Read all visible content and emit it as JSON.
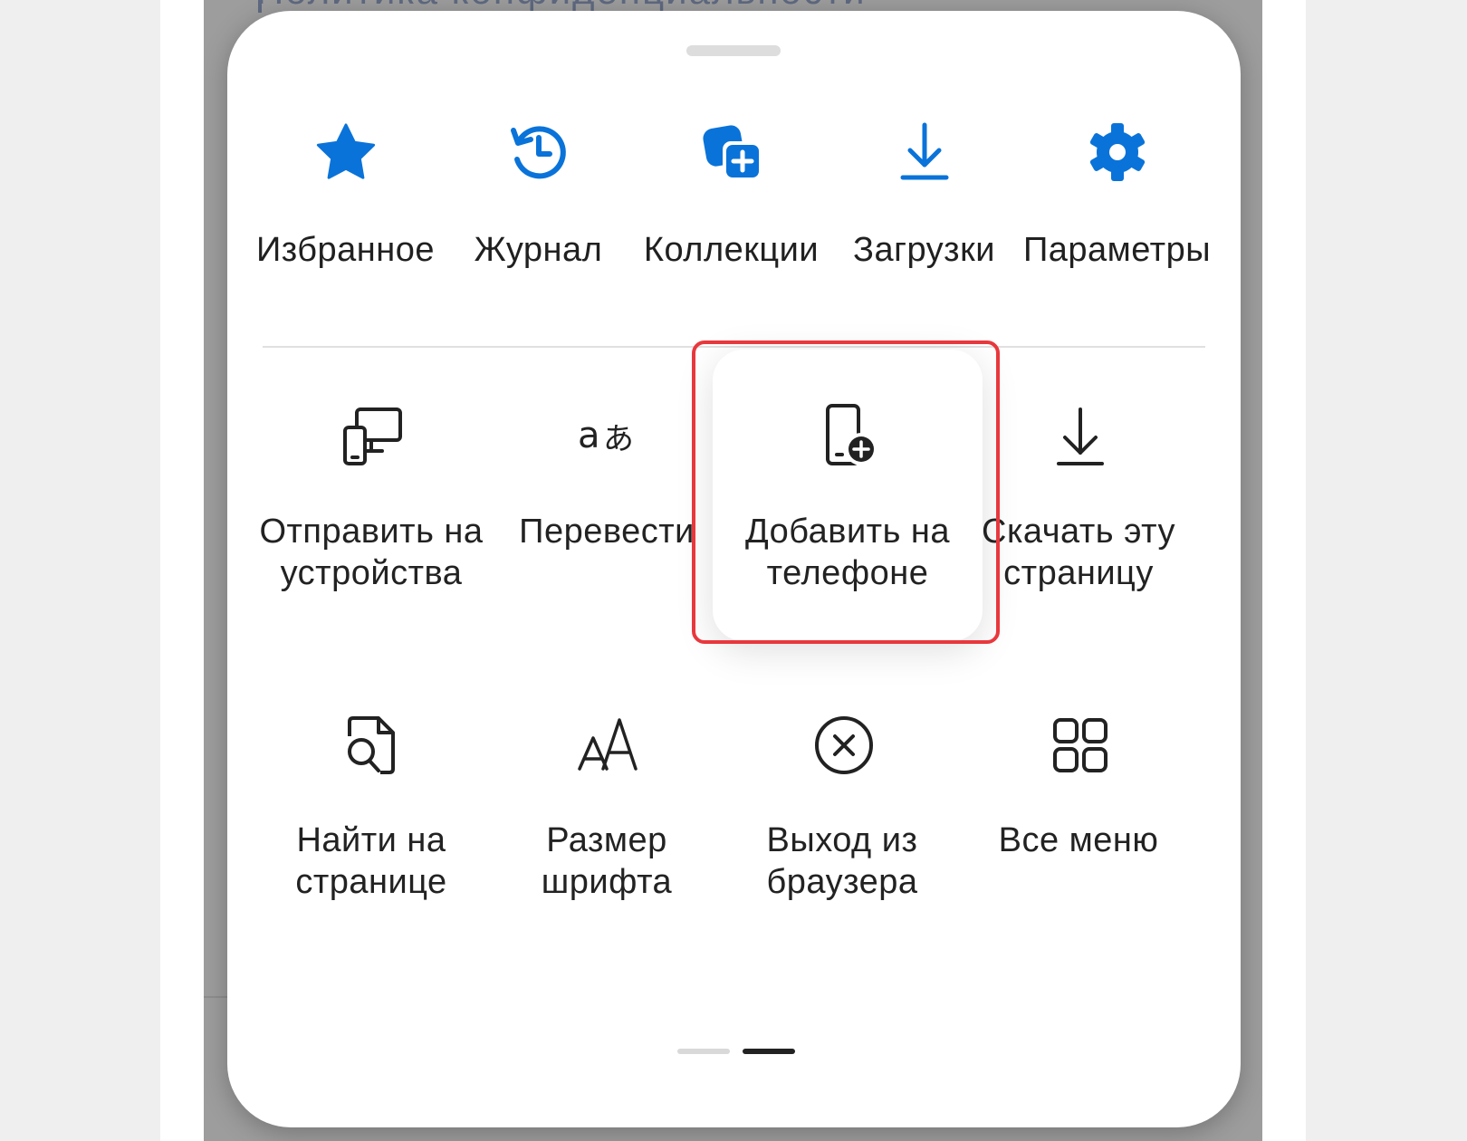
{
  "background": {
    "page_title_partial": "Политика конфиденциальности"
  },
  "colors": {
    "accent_blue": "#0a73d9",
    "icon_dark": "#222222",
    "highlight_frame": "#e8383d"
  },
  "quick_actions": [
    {
      "label": "Избранное",
      "icon": "star-icon"
    },
    {
      "label": "Журнал",
      "icon": "history-icon"
    },
    {
      "label": "Коллекции",
      "icon": "collections-icon"
    },
    {
      "label": "Загрузки",
      "icon": "download-icon"
    },
    {
      "label": "Параметры",
      "icon": "gear-icon"
    }
  ],
  "menu_items": [
    {
      "label": "Отправить на устройства",
      "icon": "send-to-devices-icon"
    },
    {
      "label": "Перевести",
      "icon": "translate-icon"
    },
    {
      "label": "Добавить на телефоне",
      "icon": "add-to-phone-icon",
      "highlighted": true
    },
    {
      "label": "Скачать эту страницу",
      "icon": "download-page-icon"
    },
    {
      "label": "Найти на странице",
      "icon": "find-on-page-icon"
    },
    {
      "label": "Размер шрифта",
      "icon": "font-size-icon"
    },
    {
      "label": "Выход из браузера",
      "icon": "exit-browser-icon"
    },
    {
      "label": "Все меню",
      "icon": "all-menu-icon"
    }
  ],
  "pagination": {
    "total_pages": 2,
    "current_page": 2
  }
}
